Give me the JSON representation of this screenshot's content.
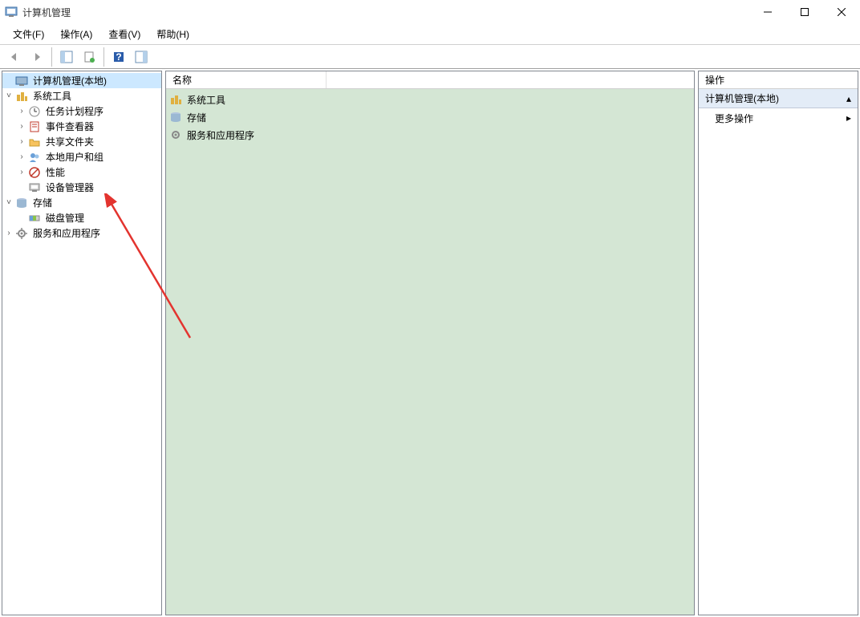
{
  "window": {
    "title": "计算机管理"
  },
  "menu": {
    "file": "文件(F)",
    "action": "操作(A)",
    "view": "查看(V)",
    "help": "帮助(H)"
  },
  "tree": {
    "root": "计算机管理(本地)",
    "systools": "系统工具",
    "scheduler": "任务计划程序",
    "eventviewer": "事件查看器",
    "sharedfolders": "共享文件夹",
    "localusers": "本地用户和组",
    "performance": "性能",
    "devicemgr": "设备管理器",
    "storage": "存储",
    "diskmgmt": "磁盘管理",
    "services": "服务和应用程序"
  },
  "list": {
    "col_name": "名称",
    "items": {
      "systools": "系统工具",
      "storage": "存储",
      "services": "服务和应用程序"
    }
  },
  "actions": {
    "header": "操作",
    "group": "计算机管理(本地)",
    "more": "更多操作"
  }
}
